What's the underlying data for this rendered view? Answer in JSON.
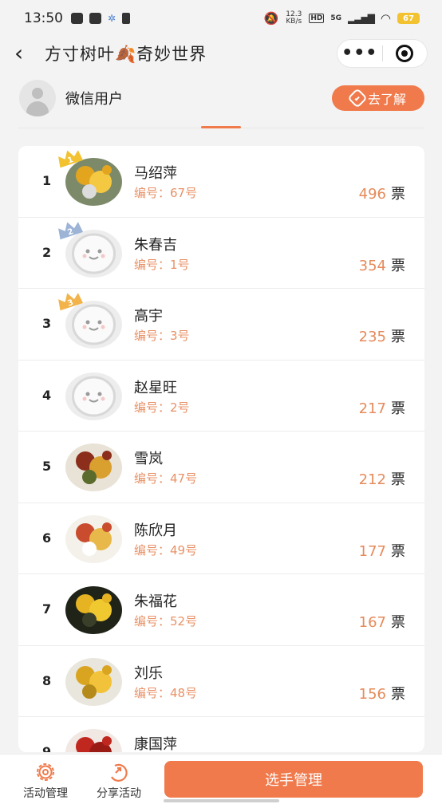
{
  "status_bar": {
    "time": "13:50",
    "net_speed": "12.3 KB/s",
    "signal_label": "5G",
    "hd_label": "HD",
    "battery": "67"
  },
  "nav": {
    "title": "方寸树叶🍂奇妙世界",
    "more_label": "•••"
  },
  "user": {
    "name": "微信用户",
    "learn_button": "去了解"
  },
  "ranking": [
    {
      "rank": "1",
      "name": "马绍萍",
      "code": "编号：67号",
      "votes": "496",
      "unit": "票",
      "crown": "1",
      "avatar": "photo-yellow"
    },
    {
      "rank": "2",
      "name": "朱春吉",
      "code": "编号：1号",
      "votes": "354",
      "unit": "票",
      "crown": "2",
      "avatar": "default-face"
    },
    {
      "rank": "3",
      "name": "高宇",
      "code": "编号：3号",
      "votes": "235",
      "unit": "票",
      "crown": "3",
      "avatar": "default-face"
    },
    {
      "rank": "4",
      "name": "赵星旺",
      "code": "编号：2号",
      "votes": "217",
      "unit": "票",
      "crown": "",
      "avatar": "default-face"
    },
    {
      "rank": "5",
      "name": "雪岚",
      "code": "编号：47号",
      "votes": "212",
      "unit": "票",
      "crown": "",
      "avatar": "photo-leaves"
    },
    {
      "rank": "6",
      "name": "陈欣月",
      "code": "编号：49号",
      "votes": "177",
      "unit": "票",
      "crown": "",
      "avatar": "photo-white"
    },
    {
      "rank": "7",
      "name": "朱福花",
      "code": "编号：52号",
      "votes": "167",
      "unit": "票",
      "crown": "",
      "avatar": "photo-dark"
    },
    {
      "rank": "8",
      "name": "刘乐",
      "code": "编号：48号",
      "votes": "156",
      "unit": "票",
      "crown": "",
      "avatar": "photo-tree"
    },
    {
      "rank": "9",
      "name": "康国萍",
      "code": "",
      "votes": "",
      "unit": "",
      "crown": "",
      "avatar": "photo-red"
    }
  ],
  "bottom": {
    "activity_manage": "活动管理",
    "share_activity": "分享活动",
    "contestant_manage": "选手管理"
  },
  "colors": {
    "accent": "#f07a4b",
    "code_text": "#e89166",
    "vote_number": "#e58a5a"
  }
}
